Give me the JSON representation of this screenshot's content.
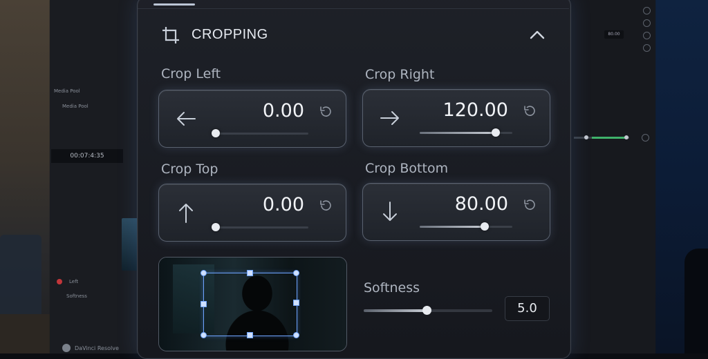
{
  "background_app": {
    "media_pool_label": "Media Pool",
    "media_pool_sub": "Media Pool",
    "timecode": "00:07:4:35",
    "track_left": "Left",
    "track_softness": "Softness",
    "brand": "DaVinci Resolve",
    "right_value": "80.00"
  },
  "panel": {
    "title": "CROPPING",
    "icons": {
      "header": "crop-icon",
      "collapse": "chevron-up-icon",
      "reset": "reset-icon",
      "left": "arrow-left-icon",
      "right": "arrow-right-icon",
      "up": "arrow-up-icon",
      "down": "arrow-down-icon"
    },
    "fields": {
      "crop_left": {
        "label": "Crop Left",
        "value": "0.00",
        "slider_fraction": 0.0
      },
      "crop_right": {
        "label": "Crop Right",
        "value": "120.00",
        "slider_fraction": 0.82
      },
      "crop_top": {
        "label": "Crop Top",
        "value": "0.00",
        "slider_fraction": 0.0
      },
      "crop_bottom": {
        "label": "Crop Bottom",
        "value": "80.00",
        "slider_fraction": 0.7
      }
    },
    "softness": {
      "label": "Softness",
      "value": "5.0",
      "slider_fraction": 0.49
    },
    "accent_color": "#6ea4ff"
  }
}
